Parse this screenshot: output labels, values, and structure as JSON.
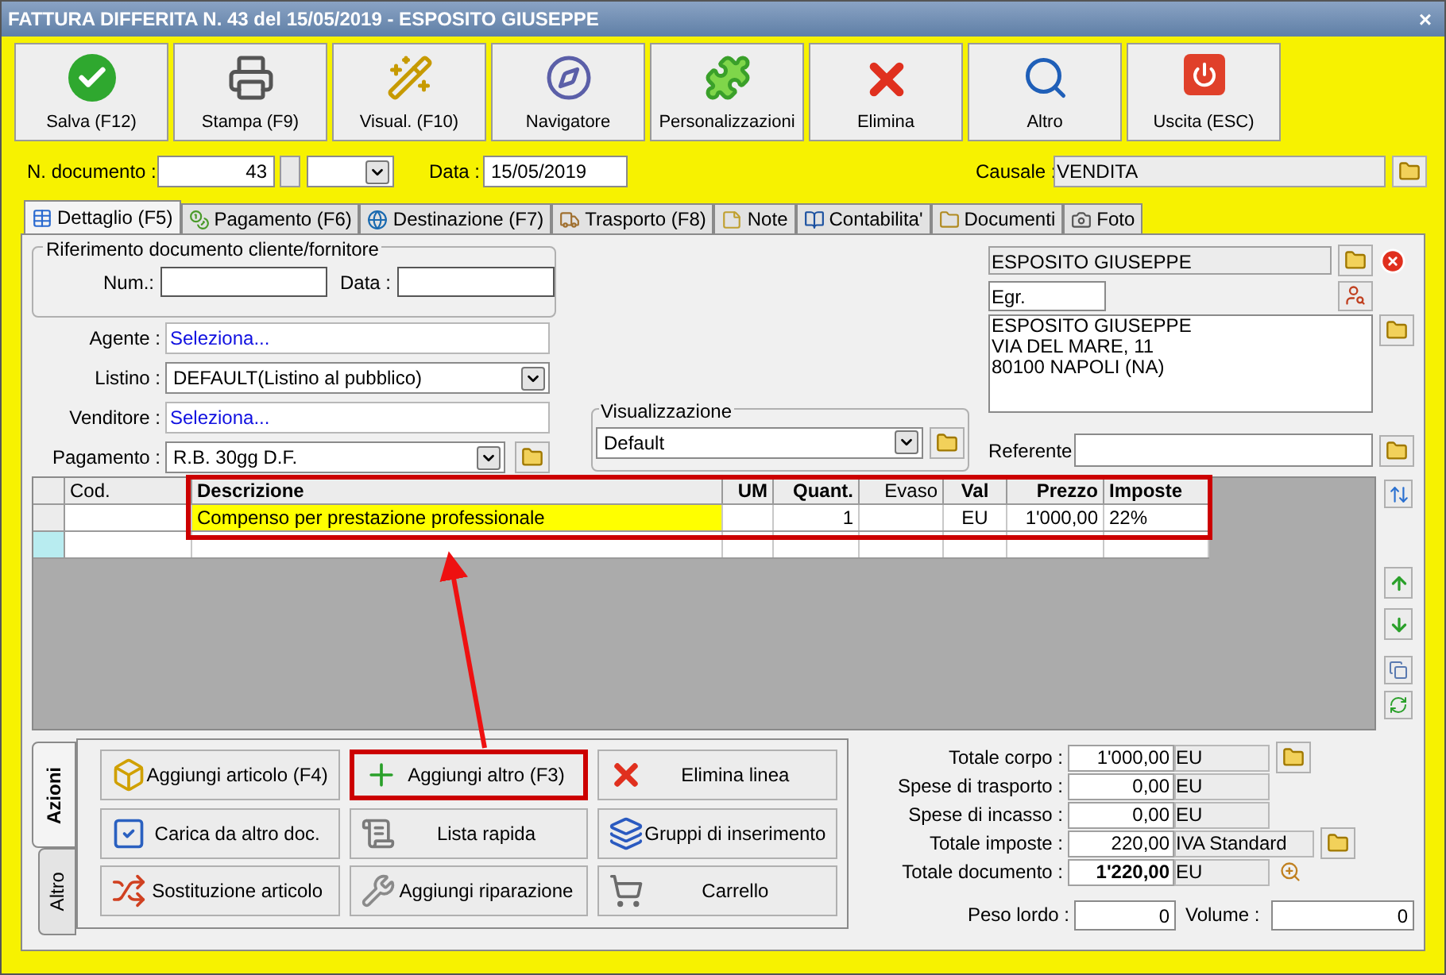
{
  "window": {
    "title": "FATTURA DIFFERITA N. 43 del 15/05/2019 - ESPOSITO GIUSEPPE",
    "close": "×"
  },
  "toolbar": [
    "Salva (F12)",
    "Stampa (F9)",
    "Visual. (F10)",
    "Navigatore",
    "Personalizzazioni",
    "Elimina",
    "Altro",
    "Uscita (ESC)"
  ],
  "document": {
    "number_label": "N. documento :",
    "number": "43",
    "date_label": "Data :",
    "date": "15/05/2019",
    "causale_label": "Causale :",
    "causale": "VENDITA"
  },
  "tabs": [
    {
      "label": "Dettaglio (F5)",
      "selected": true
    },
    {
      "label": "Pagamento (F6)",
      "selected": false
    },
    {
      "label": "Destinazione (F7)",
      "selected": false
    },
    {
      "label": "Trasporto (F8)",
      "selected": false
    },
    {
      "label": "Note",
      "selected": false
    },
    {
      "label": "Contabilita'",
      "selected": false
    },
    {
      "label": "Documenti",
      "selected": false
    },
    {
      "label": "Foto",
      "selected": false
    }
  ],
  "reference": {
    "title": "Riferimento documento cliente/fornitore",
    "num_label": "Num.:",
    "date_label": "Data :"
  },
  "fields": [
    {
      "kind": "link",
      "label": "Agente :",
      "value": "Seleziona..."
    },
    {
      "kind": "combo",
      "label": "Listino :",
      "value": "DEFAULT(Listino al pubblico)"
    },
    {
      "kind": "link",
      "label": "Venditore :",
      "value": "Seleziona..."
    },
    {
      "kind": "combo_folder",
      "label": "Pagamento :",
      "value": "R.B. 30gg D.F."
    }
  ],
  "view": {
    "title": "Visualizzazione",
    "value": "Default"
  },
  "customer": {
    "name": "ESPOSITO GIUSEPPE",
    "salutation": "Egr.",
    "address": [
      "ESPOSITO GIUSEPPE",
      "VIA DEL MARE, 11",
      "80100 NAPOLI (NA)"
    ],
    "contact_label": "Referente"
  },
  "table": {
    "highlighted": true,
    "columns": [
      {
        "label": "Cod.",
        "bold": false
      },
      {
        "label": "Descrizione",
        "bold": true
      },
      {
        "label": "UM",
        "bold": true
      },
      {
        "label": "Quant.",
        "bold": true
      },
      {
        "label": "Evaso",
        "bold": false
      },
      {
        "label": "Val",
        "bold": true
      },
      {
        "label": "Prezzo",
        "bold": true
      },
      {
        "label": "Imposte",
        "bold": true
      }
    ],
    "rows": [
      {
        "current": true,
        "cells": [
          "",
          "Compenso per prestazione professionale",
          "",
          "1",
          "",
          "EU",
          "1'000,00",
          "22%"
        ]
      }
    ]
  },
  "annotation_arrow": true,
  "action_tabs": [
    {
      "label": "Azioni",
      "selected": true
    },
    {
      "label": "Altro",
      "selected": false
    }
  ],
  "actions": [
    {
      "label": "Aggiungi articolo (F4)",
      "highlighted": false
    },
    {
      "label": "Aggiungi altro (F3)",
      "highlighted": true
    },
    {
      "label": "Elimina linea",
      "highlighted": false
    },
    {
      "label": "Carica da altro doc.",
      "highlighted": false
    },
    {
      "label": "Lista rapida",
      "highlighted": false
    },
    {
      "label": "Gruppi di inserimento",
      "highlighted": false
    },
    {
      "label": "Sostituzione articolo",
      "highlighted": false
    },
    {
      "label": "Aggiungi riparazione",
      "highlighted": false
    },
    {
      "label": "Carrello",
      "highlighted": false
    }
  ],
  "totals": [
    {
      "label": "Totale corpo :",
      "value": "1'000,00",
      "unit": "EU",
      "bold": false
    },
    {
      "label": "Spese di trasporto :",
      "value": "0,00",
      "unit": "EU",
      "bold": false
    },
    {
      "label": "Spese di incasso :",
      "value": "0,00",
      "unit": "EU",
      "bold": false
    },
    {
      "label": "Totale imposte :",
      "value": "220,00",
      "unit": "IVA Standard",
      "bold": false
    },
    {
      "label": "Totale documento :",
      "value": "1'220,00",
      "unit": "EU",
      "bold": true
    }
  ],
  "weight": {
    "label": "Peso lordo :",
    "value": "0"
  },
  "volume": {
    "label": "Volume :",
    "value": "0"
  }
}
